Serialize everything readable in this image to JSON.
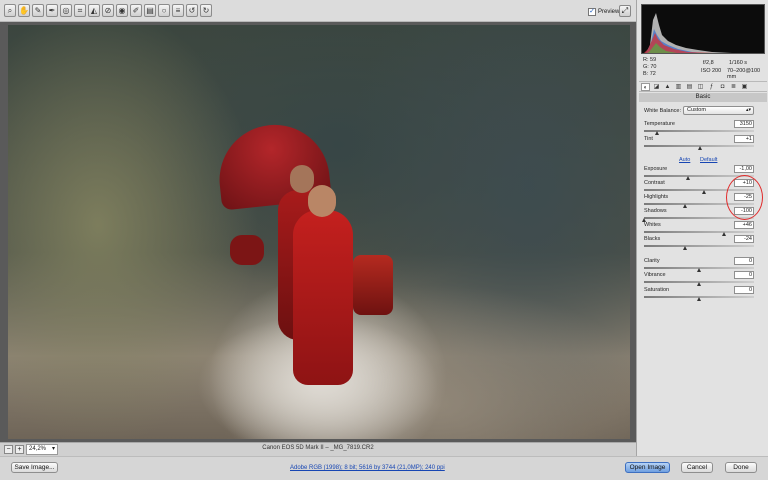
{
  "toolbar": {
    "tools": [
      "zoom-icon",
      "hand-icon",
      "eyedropper-icon",
      "color-sampler-icon",
      "target-adjust-icon",
      "crop-icon",
      "straighten-icon",
      "spot-removal-icon",
      "red-eye-icon",
      "brush-icon",
      "graduated-filter-icon",
      "radial-filter-icon",
      "preferences-icon",
      "rotate-ccw-icon",
      "rotate-cw-icon"
    ],
    "preview_label": "Preview",
    "preview_checked": true
  },
  "status": {
    "zoom": "24,2%",
    "filename": "Canon EOS 5D Mark II  –  _MG_7819.CR2"
  },
  "bottom": {
    "save": "Save Image...",
    "workflow": "Adobe RGB (1998); 8 bit; 5616 by 3744 (21,0MP); 240 ppi",
    "open": "Open Image",
    "cancel": "Cancel",
    "done": "Done"
  },
  "readout": {
    "r_label": "R:",
    "r": "59",
    "g_label": "G:",
    "g": "70",
    "b_label": "B:",
    "b": "72",
    "aperture": "f/2,8",
    "shutter": "1/160 s",
    "iso": "ISO 200",
    "lens": "70–200@100 mm"
  },
  "panel": {
    "section": "Basic",
    "wb_label": "White Balance:",
    "wb_value": "Custom",
    "auto": "Auto",
    "default": "Default",
    "sliders": [
      {
        "key": "temperature",
        "label": "Temperature",
        "value": "3150",
        "pos": 0.12
      },
      {
        "key": "tint",
        "label": "Tint",
        "value": "+1",
        "pos": 0.51
      },
      {
        "key": "exposure",
        "label": "Exposure",
        "value": "-1,00",
        "pos": 0.4
      },
      {
        "key": "contrast",
        "label": "Contrast",
        "value": "+10",
        "pos": 0.55
      },
      {
        "key": "highlights",
        "label": "Highlights",
        "value": "-25",
        "pos": 0.375
      },
      {
        "key": "shadows",
        "label": "Shadows",
        "value": "-100",
        "pos": 0.0
      },
      {
        "key": "whites",
        "label": "Whites",
        "value": "+46",
        "pos": 0.73
      },
      {
        "key": "blacks",
        "label": "Blacks",
        "value": "-24",
        "pos": 0.38
      },
      {
        "key": "clarity",
        "label": "Clarity",
        "value": "0",
        "pos": 0.5
      },
      {
        "key": "vibrance",
        "label": "Vibrance",
        "value": "0",
        "pos": 0.5
      },
      {
        "key": "saturation",
        "label": "Saturation",
        "value": "0",
        "pos": 0.5
      }
    ]
  },
  "colors": {
    "annotation": "#e12b2b",
    "accent_button": "#6f9fe0",
    "link": "#1746b3"
  }
}
